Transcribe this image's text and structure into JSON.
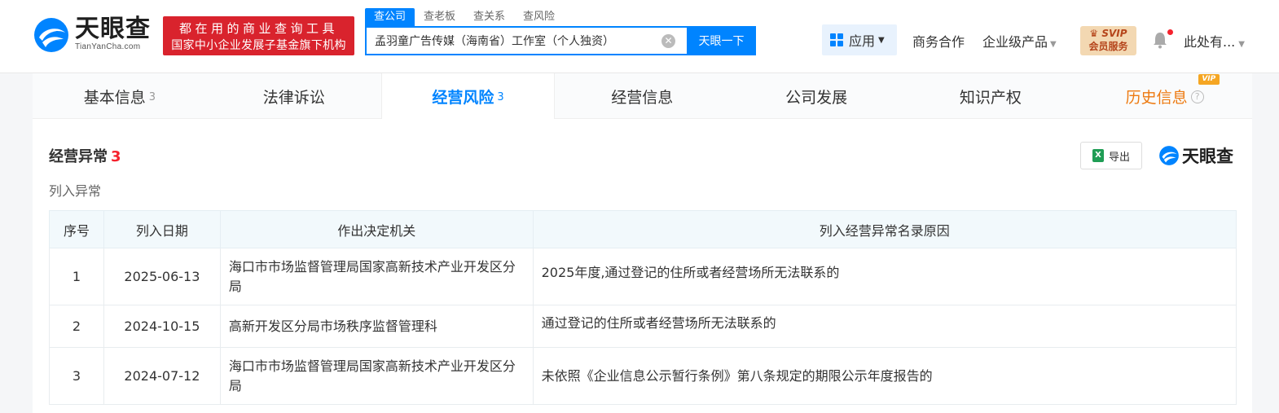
{
  "header": {
    "logo_text": "天眼查",
    "logo_sub": "TianYanCha.com",
    "slogan_line1": "都在用的商业查询工具",
    "slogan_line2": "国家中小企业发展子基金旗下机构",
    "search_tabs": [
      "查公司",
      "查老板",
      "查关系",
      "查风险"
    ],
    "search_value": "孟羽童广告传媒（海南省）工作室（个人独资）",
    "search_button": "天眼一下",
    "clear_glyph": "✕",
    "app_label": "应用",
    "nav_business": "商务合作",
    "nav_enterprise": "企业级产品",
    "svip_line1": "SVIP",
    "svip_line2": "会员服务",
    "user_name": "此处有..."
  },
  "tabs": [
    {
      "label": "基本信息",
      "count": "3"
    },
    {
      "label": "法律诉讼",
      "count": ""
    },
    {
      "label": "经营风险",
      "count": "3"
    },
    {
      "label": "经营信息",
      "count": ""
    },
    {
      "label": "公司发展",
      "count": ""
    },
    {
      "label": "知识产权",
      "count": ""
    },
    {
      "label": "历史信息",
      "count": ""
    }
  ],
  "vip_badge": "VIP",
  "help_glyph": "?",
  "section": {
    "title": "经营异常",
    "count": "3",
    "subtitle": "列入异常",
    "export_label": "导出",
    "xls_glyph": "X",
    "mini_logo": "天眼查"
  },
  "table": {
    "headers": [
      "序号",
      "列入日期",
      "作出决定机关",
      "列入经营异常名录原因"
    ],
    "rows": [
      {
        "no": "1",
        "date": "2025-06-13",
        "org": "海口市市场监督管理局国家高新技术产业开发区分局",
        "reason": "2025年度,通过登记的住所或者经营场所无法联系的"
      },
      {
        "no": "2",
        "date": "2024-10-15",
        "org": "高新开发区分局市场秩序监督管理科",
        "reason": "通过登记的住所或者经营场所无法联系的"
      },
      {
        "no": "3",
        "date": "2024-07-12",
        "org": "海口市市场监督管理局国家高新技术产业开发区分局",
        "reason": "未依照《企业信息公示暂行条例》第八条规定的期限公示年度报告的"
      }
    ]
  },
  "colors": {
    "brand_blue": "#0084ff",
    "slogan_red": "#d9232d",
    "count_red": "#f5222d",
    "history_orange": "#ed7a11"
  }
}
